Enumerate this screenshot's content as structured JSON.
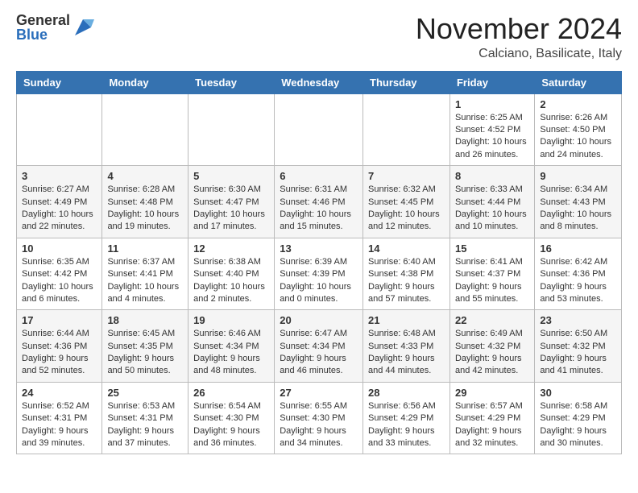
{
  "logo": {
    "general": "General",
    "blue": "Blue"
  },
  "header": {
    "month": "November 2024",
    "location": "Calciano, Basilicate, Italy"
  },
  "weekdays": [
    "Sunday",
    "Monday",
    "Tuesday",
    "Wednesday",
    "Thursday",
    "Friday",
    "Saturday"
  ],
  "weeks": [
    [
      {
        "day": "",
        "info": ""
      },
      {
        "day": "",
        "info": ""
      },
      {
        "day": "",
        "info": ""
      },
      {
        "day": "",
        "info": ""
      },
      {
        "day": "",
        "info": ""
      },
      {
        "day": "1",
        "info": "Sunrise: 6:25 AM\nSunset: 4:52 PM\nDaylight: 10 hours and 26 minutes."
      },
      {
        "day": "2",
        "info": "Sunrise: 6:26 AM\nSunset: 4:50 PM\nDaylight: 10 hours and 24 minutes."
      }
    ],
    [
      {
        "day": "3",
        "info": "Sunrise: 6:27 AM\nSunset: 4:49 PM\nDaylight: 10 hours and 22 minutes."
      },
      {
        "day": "4",
        "info": "Sunrise: 6:28 AM\nSunset: 4:48 PM\nDaylight: 10 hours and 19 minutes."
      },
      {
        "day": "5",
        "info": "Sunrise: 6:30 AM\nSunset: 4:47 PM\nDaylight: 10 hours and 17 minutes."
      },
      {
        "day": "6",
        "info": "Sunrise: 6:31 AM\nSunset: 4:46 PM\nDaylight: 10 hours and 15 minutes."
      },
      {
        "day": "7",
        "info": "Sunrise: 6:32 AM\nSunset: 4:45 PM\nDaylight: 10 hours and 12 minutes."
      },
      {
        "day": "8",
        "info": "Sunrise: 6:33 AM\nSunset: 4:44 PM\nDaylight: 10 hours and 10 minutes."
      },
      {
        "day": "9",
        "info": "Sunrise: 6:34 AM\nSunset: 4:43 PM\nDaylight: 10 hours and 8 minutes."
      }
    ],
    [
      {
        "day": "10",
        "info": "Sunrise: 6:35 AM\nSunset: 4:42 PM\nDaylight: 10 hours and 6 minutes."
      },
      {
        "day": "11",
        "info": "Sunrise: 6:37 AM\nSunset: 4:41 PM\nDaylight: 10 hours and 4 minutes."
      },
      {
        "day": "12",
        "info": "Sunrise: 6:38 AM\nSunset: 4:40 PM\nDaylight: 10 hours and 2 minutes."
      },
      {
        "day": "13",
        "info": "Sunrise: 6:39 AM\nSunset: 4:39 PM\nDaylight: 10 hours and 0 minutes."
      },
      {
        "day": "14",
        "info": "Sunrise: 6:40 AM\nSunset: 4:38 PM\nDaylight: 9 hours and 57 minutes."
      },
      {
        "day": "15",
        "info": "Sunrise: 6:41 AM\nSunset: 4:37 PM\nDaylight: 9 hours and 55 minutes."
      },
      {
        "day": "16",
        "info": "Sunrise: 6:42 AM\nSunset: 4:36 PM\nDaylight: 9 hours and 53 minutes."
      }
    ],
    [
      {
        "day": "17",
        "info": "Sunrise: 6:44 AM\nSunset: 4:36 PM\nDaylight: 9 hours and 52 minutes."
      },
      {
        "day": "18",
        "info": "Sunrise: 6:45 AM\nSunset: 4:35 PM\nDaylight: 9 hours and 50 minutes."
      },
      {
        "day": "19",
        "info": "Sunrise: 6:46 AM\nSunset: 4:34 PM\nDaylight: 9 hours and 48 minutes."
      },
      {
        "day": "20",
        "info": "Sunrise: 6:47 AM\nSunset: 4:34 PM\nDaylight: 9 hours and 46 minutes."
      },
      {
        "day": "21",
        "info": "Sunrise: 6:48 AM\nSunset: 4:33 PM\nDaylight: 9 hours and 44 minutes."
      },
      {
        "day": "22",
        "info": "Sunrise: 6:49 AM\nSunset: 4:32 PM\nDaylight: 9 hours and 42 minutes."
      },
      {
        "day": "23",
        "info": "Sunrise: 6:50 AM\nSunset: 4:32 PM\nDaylight: 9 hours and 41 minutes."
      }
    ],
    [
      {
        "day": "24",
        "info": "Sunrise: 6:52 AM\nSunset: 4:31 PM\nDaylight: 9 hours and 39 minutes."
      },
      {
        "day": "25",
        "info": "Sunrise: 6:53 AM\nSunset: 4:31 PM\nDaylight: 9 hours and 37 minutes."
      },
      {
        "day": "26",
        "info": "Sunrise: 6:54 AM\nSunset: 4:30 PM\nDaylight: 9 hours and 36 minutes."
      },
      {
        "day": "27",
        "info": "Sunrise: 6:55 AM\nSunset: 4:30 PM\nDaylight: 9 hours and 34 minutes."
      },
      {
        "day": "28",
        "info": "Sunrise: 6:56 AM\nSunset: 4:29 PM\nDaylight: 9 hours and 33 minutes."
      },
      {
        "day": "29",
        "info": "Sunrise: 6:57 AM\nSunset: 4:29 PM\nDaylight: 9 hours and 32 minutes."
      },
      {
        "day": "30",
        "info": "Sunrise: 6:58 AM\nSunset: 4:29 PM\nDaylight: 9 hours and 30 minutes."
      }
    ]
  ]
}
